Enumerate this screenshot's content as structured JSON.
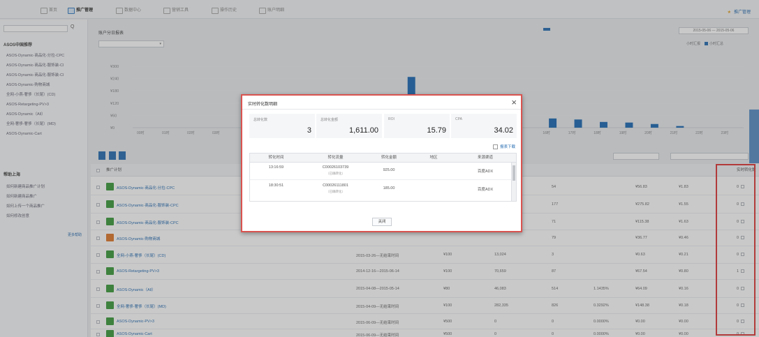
{
  "topnav": {
    "tabs": [
      "首页",
      "推广管理",
      "数据中心",
      "营销工具",
      "操作历史",
      "账户明细"
    ],
    "active_index": 1,
    "notice": "推广管理"
  },
  "sidebar": {
    "search_placeholder": "",
    "search_button": "Q",
    "group1_title": "ASOS中国推荐",
    "group1_items": [
      "ASOS-Dynamic-商品化-分拉-CPC",
      "ASOS-Dynamic-商品化-服饰装-CI",
      "ASOS-Dynamic-商品化-服饰装-CI",
      "ASOS-Dynamic-购物商城",
      "全网-小燕-奢侈（长尾）(CD)",
      "ASOS-Retargeting-PV>3",
      "ASOS-Dynamic（All）",
      "全网-奢侈-奢侈（长尾）(MD)",
      "ASOS-Dynamic-Cart"
    ],
    "group2_title": "帮助上海",
    "group2_items": [
      "如何新建商品推广计划",
      "如何新建商品推广",
      "如何上传一个商品推广",
      "如何修改创意"
    ],
    "more_link": "更多帮助"
  },
  "main": {
    "section_title": "账户分日报表",
    "select_value": "",
    "metric_radios": [
      "",
      "",
      "",
      "",
      "",
      "",
      "",
      ""
    ],
    "range_buttons": [
      "",
      "",
      "",
      "",
      "",
      "",
      "",
      ""
    ],
    "range_active": 0,
    "date_range": "2015-05-06 — 2015-05-06",
    "legend": [
      "小时汇报",
      "小时汇总"
    ],
    "buttons": [
      "",
      "",
      "",
      ""
    ],
    "buttons_plain": "",
    "table_filter": "",
    "table_search_placeholder": ""
  },
  "chart_data": {
    "type": "bar",
    "y_ticks": [
      "¥300",
      "¥240",
      "¥180",
      "¥120",
      "¥60",
      "¥0"
    ],
    "x_ticks_left": [
      "00时",
      "01时",
      "02时",
      "03时"
    ],
    "x_ticks_right": [
      "16时",
      "17时",
      "18时",
      "19时",
      "20时",
      "21时",
      "22时",
      "23时"
    ],
    "values": [
      0,
      0,
      0,
      0,
      0,
      0,
      0,
      0,
      0,
      0,
      0,
      0,
      0,
      0,
      0,
      0,
      45,
      40,
      28,
      25,
      18,
      8,
      0,
      0
    ],
    "highlight_value": 248
  },
  "table": {
    "headers": [
      "推广计划",
      "",
      "",
      "",
      "",
      "",
      "",
      "",
      "",
      "",
      "",
      "实时转化数"
    ],
    "rows": [
      {
        "name": "ASOS-Dynamic-商品化-分拉-CPC",
        "type": "",
        "status": "",
        "date": "",
        "budget": "",
        "c1": "",
        "c2": "54",
        "c3": "",
        "c4": "¥56.83",
        "c5": "¥1.83",
        "live": "0",
        "orange": false
      },
      {
        "name": "ASOS-Dynamic-商品化-服饰装-CPC",
        "type": "",
        "status": "",
        "date": "",
        "budget": "",
        "c1": "",
        "c2": "177",
        "c3": "",
        "c4": "¥275.82",
        "c5": "¥1.55",
        "live": "0",
        "orange": false
      },
      {
        "name": "ASOS-Dynamic-商品化-服饰装-CPC",
        "type": "",
        "status": "",
        "date": "",
        "budget": "",
        "c1": "",
        "c2": "71",
        "c3": "",
        "c4": "¥115.38",
        "c5": "¥1.63",
        "live": "0",
        "orange": false
      },
      {
        "name": "ASOS-Dynamic-购物商城",
        "type": "",
        "status": "",
        "date": "",
        "budget": "",
        "c1": "",
        "c2": "79",
        "c3": "",
        "c4": "¥36.77",
        "c5": "¥0.46",
        "live": "0",
        "orange": true
      },
      {
        "name": "全网-小燕-奢侈（长尾）(CD)",
        "type": "",
        "status": "",
        "date": "2015-03-26—无结束时间",
        "budget": "¥100",
        "c1": "13,024",
        "c2": "3",
        "c3": "",
        "c4": "¥0.63",
        "c5": "¥0.21",
        "live": "0",
        "orange": false
      },
      {
        "name": "ASOS-Retargeting-PV>3",
        "type": "",
        "status": "",
        "date": "2014-12-16—2015-06-14",
        "budget": "¥100",
        "c1": "70,659",
        "c2": "87",
        "c3": "",
        "c4": "¥67.54",
        "c5": "¥0.80",
        "live": "1",
        "orange": false
      },
      {
        "name": "ASOS-Dynamic（All）",
        "type": "",
        "status": "",
        "date": "2015-04-08—2015-05-14",
        "budget": "¥80",
        "c1": "46,083",
        "c2": "514",
        "c3": "1.1435%",
        "c4": "¥64.09",
        "c5": "¥0.16",
        "live": "0",
        "orange": false
      },
      {
        "name": "全网-奢侈-奢侈（长尾）(MD)",
        "type": "",
        "status": "",
        "date": "2015-04-09—无结束时间",
        "budget": "¥100",
        "c1": "282,335",
        "c2": "826",
        "c3": "0.3292%",
        "c4": "¥148.38",
        "c5": "¥0.18",
        "live": "0",
        "orange": false
      },
      {
        "name": "ASOS-Dynamic-PV>3",
        "type": "",
        "status": "",
        "date": "2015-06-09—无结束时间",
        "budget": "¥500",
        "c1": "0",
        "c2": "0",
        "c3": "0.0000%",
        "c4": "¥0.00",
        "c5": "¥0.00",
        "live": "0",
        "orange": false
      },
      {
        "name": "ASOS-Dynamic-Cart",
        "type": "",
        "status": "",
        "date": "2015-06-09—无结束时间",
        "budget": "¥500",
        "c1": "0",
        "c2": "0",
        "c3": "0.0000%",
        "c4": "¥0.00",
        "c5": "¥0.00",
        "live": "0",
        "orange": false
      }
    ]
  },
  "modal": {
    "title": "实时转化数明细",
    "stats": [
      {
        "label": "总转化数",
        "value": "3"
      },
      {
        "label": "总转化金额",
        "value": "1,611.00"
      },
      {
        "label": "ROI",
        "value": "15.79"
      },
      {
        "label": "CPA",
        "value": "34.02"
      }
    ],
    "note": "",
    "export_label": "报表下载",
    "columns": [
      "转化时间",
      "转化流量",
      "转化金额",
      "地区",
      "来源渠道"
    ],
    "rows": [
      {
        "time": "13:16:59",
        "time_sub": "",
        "order": "C00026103739",
        "order_sub": "（已确转化）",
        "amount": "925.00",
        "region": "",
        "channel": "百度ADX"
      },
      {
        "time": "18:30:51",
        "time_sub": "",
        "order": "C00026111801",
        "order_sub": "（已确转化）",
        "amount": "185.00",
        "region": "",
        "channel": "百度ADX"
      }
    ],
    "footer": "",
    "close_button": "关闭"
  }
}
